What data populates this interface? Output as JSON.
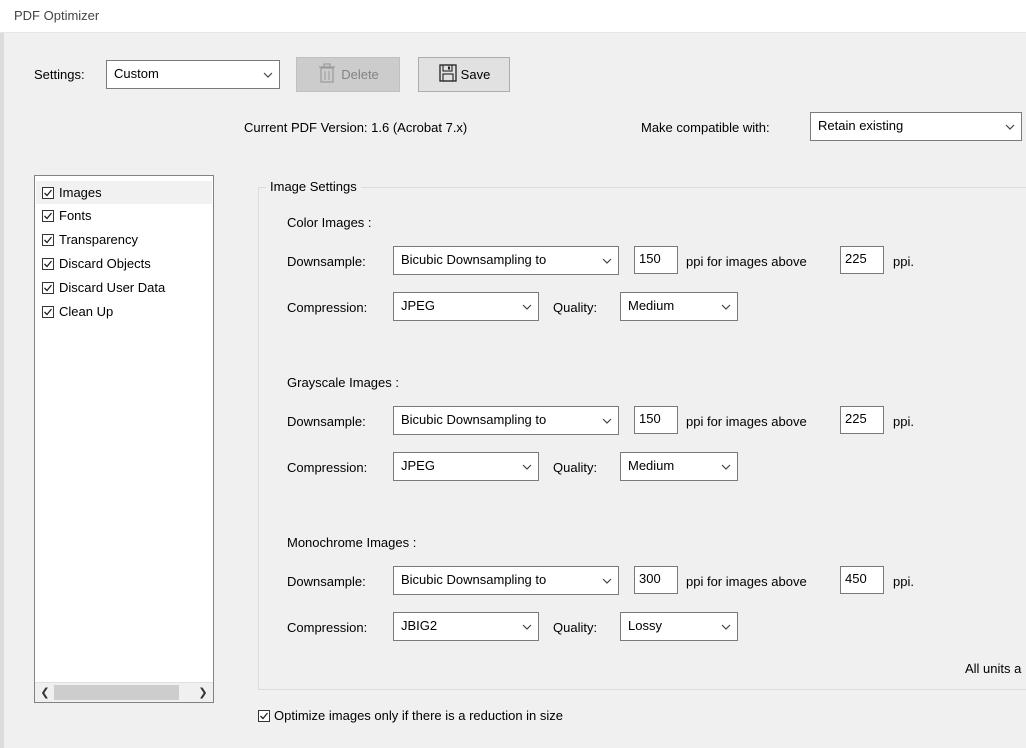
{
  "window": {
    "title": "PDF Optimizer"
  },
  "settings": {
    "label": "Settings:",
    "value": "Custom",
    "delete_label": "Delete",
    "save_label": "Save"
  },
  "version": {
    "current_label": "Current PDF Version: 1.6 (Acrobat 7.x)",
    "compat_label": "Make compatible with:",
    "compat_value": "Retain existing"
  },
  "panel_list": {
    "items": [
      {
        "label": "Images",
        "checked": true,
        "selected": true
      },
      {
        "label": "Fonts",
        "checked": true
      },
      {
        "label": "Transparency",
        "checked": true
      },
      {
        "label": "Discard Objects",
        "checked": true
      },
      {
        "label": "Discard User Data",
        "checked": true
      },
      {
        "label": "Clean Up",
        "checked": true
      }
    ]
  },
  "image_settings": {
    "title": "Image Settings",
    "color": {
      "heading": "Color Images :",
      "downsample_label": "Downsample:",
      "downsample_method": "Bicubic Downsampling to",
      "ppi": "150",
      "above_label": "ppi for images above",
      "above_ppi": "225",
      "ppi_suffix": "ppi.",
      "compression_label": "Compression:",
      "compression": "JPEG",
      "quality_label": "Quality:",
      "quality": "Medium"
    },
    "grayscale": {
      "heading": "Grayscale Images :",
      "downsample_label": "Downsample:",
      "downsample_method": "Bicubic Downsampling to",
      "ppi": "150",
      "above_label": "ppi for images above",
      "above_ppi": "225",
      "ppi_suffix": "ppi.",
      "compression_label": "Compression:",
      "compression": "JPEG",
      "quality_label": "Quality:",
      "quality": "Medium"
    },
    "monochrome": {
      "heading": "Monochrome Images :",
      "downsample_label": "Downsample:",
      "downsample_method": "Bicubic Downsampling to",
      "ppi": "300",
      "above_label": "ppi for images above",
      "above_ppi": "450",
      "ppi_suffix": "ppi.",
      "compression_label": "Compression:",
      "compression": "JBIG2",
      "quality_label": "Quality:",
      "quality": "Lossy"
    },
    "units_note": "All units a"
  },
  "optimize_option": {
    "label": "Optimize images only if there is a reduction in size",
    "checked": true
  },
  "icons": {
    "chevron": "chevron-down-icon",
    "delete": "trash-icon",
    "save": "floppy-disk-icon"
  }
}
